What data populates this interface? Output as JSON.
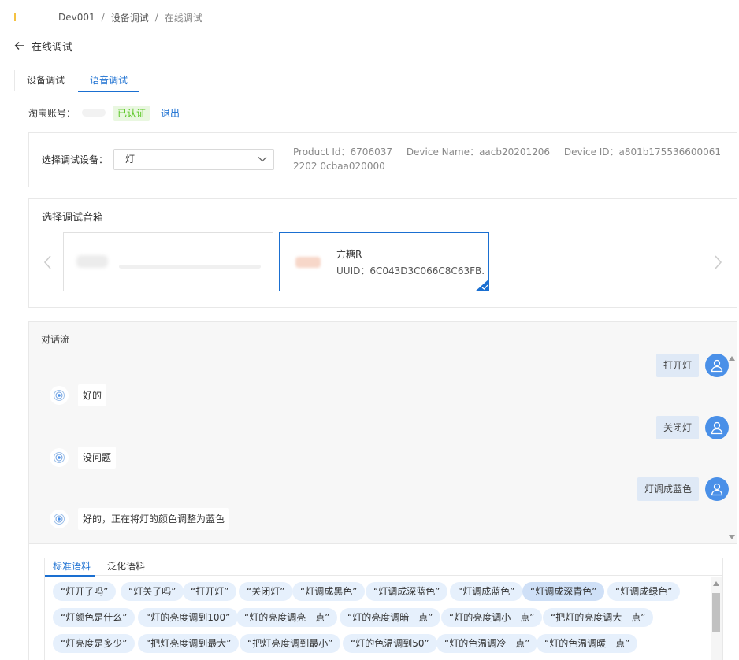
{
  "breadcrumb": {
    "items": [
      "Dev001",
      "设备调试",
      "在线调试"
    ],
    "separator": "/"
  },
  "page_title": "在线调试",
  "tabs": [
    {
      "label": "设备调试",
      "active": false
    },
    {
      "label": "语音调试",
      "active": true
    }
  ],
  "account": {
    "label": "淘宝账号：",
    "badge": "已认证",
    "logout": "退出"
  },
  "device": {
    "label": "选择调试设备：",
    "selected": "灯",
    "product_id": "Product Id：6706037",
    "device_name": "Device Name：aacb20201206",
    "device_id": "Device ID：a801b1755366000612202 0cbaa020000"
  },
  "speaker": {
    "title": "选择调试音箱",
    "cards": [
      {
        "name": "",
        "selected": false
      },
      {
        "name": "方糖R",
        "uuid": "UUID：6C043D3C066C8C63FB...",
        "selected": true
      }
    ]
  },
  "dialog": {
    "title": "对话流",
    "messages": [
      {
        "role": "user",
        "text": "打开灯"
      },
      {
        "role": "bot",
        "text": "好的"
      },
      {
        "role": "user",
        "text": "关闭灯"
      },
      {
        "role": "bot",
        "text": "没问题"
      },
      {
        "role": "user",
        "text": "灯调成蓝色"
      },
      {
        "role": "bot",
        "text": "好的，正在将灯的颜色调整为蓝色"
      }
    ]
  },
  "corpus": {
    "tabs": [
      {
        "label": "标准语料",
        "active": true
      },
      {
        "label": "泛化语料",
        "active": false
      }
    ],
    "chips": [
      "“灯开了吗”",
      "“灯关了吗”",
      "“打开灯”",
      "“关闭灯”",
      "“灯调成黑色”",
      "“灯调成深蓝色”",
      "“灯调成蓝色”",
      "“灯调成深青色”",
      "“灯调成绿色”",
      "“灯颜色是什么”",
      "“灯的亮度调到100”",
      "“灯的亮度调亮一点”",
      "“灯的亮度调暗一点”",
      "“灯的亮度调小一点”",
      "“把灯的亮度调大一点”",
      "“灯亮度是多少”",
      "“把灯亮度调到最大”",
      "“把灯亮度调到最小”",
      "“灯的色温调到50”",
      "“灯的色温调冷一点”",
      "“灯的色温调暖一点”"
    ],
    "highlighted_chip": "“灯调成深青色”"
  },
  "colors": {
    "accent": "#1a6fd1",
    "avatar": "#4a90e8",
    "chip_bg": "#e6f0fc",
    "user_bubble": "#dfe9f6",
    "verified": "#52c41a"
  }
}
